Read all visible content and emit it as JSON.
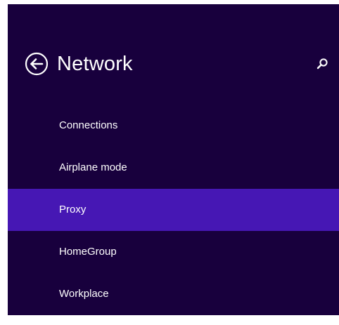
{
  "header": {
    "title": "Network",
    "back_icon": "back-arrow-circle-icon",
    "search_icon": "search-icon"
  },
  "nav": {
    "selected": "Proxy",
    "items": [
      {
        "label": "Connections"
      },
      {
        "label": "Airplane mode"
      },
      {
        "label": "Proxy"
      },
      {
        "label": "HomeGroup"
      },
      {
        "label": "Workplace"
      }
    ]
  },
  "colors": {
    "background": "#18003d",
    "selected": "#4617b4",
    "text": "#ffffff"
  }
}
